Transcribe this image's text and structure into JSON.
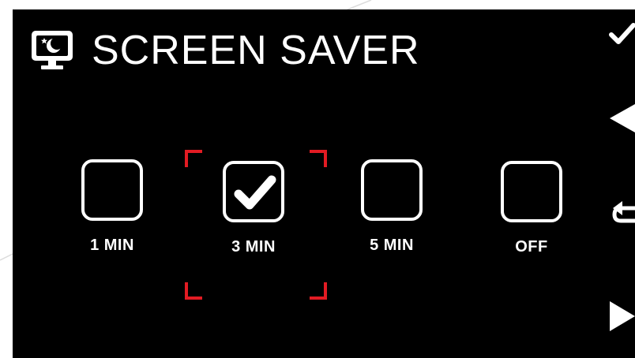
{
  "header": {
    "title": "SCREEN SAVER",
    "icon": "monitor-moon-icon"
  },
  "options": [
    {
      "label": "1 MIN",
      "checked": false
    },
    {
      "label": "3 MIN",
      "checked": true
    },
    {
      "label": "5 MIN",
      "checked": false
    },
    {
      "label": "OFF",
      "checked": false
    }
  ],
  "selected_option": "3 MIN",
  "side_buttons": [
    "check-icon",
    "left-arrow-icon",
    "return-icon",
    "right-arrow-icon"
  ],
  "colors": {
    "background": "#000000",
    "foreground": "#ffffff",
    "selection": "#e21b23"
  }
}
